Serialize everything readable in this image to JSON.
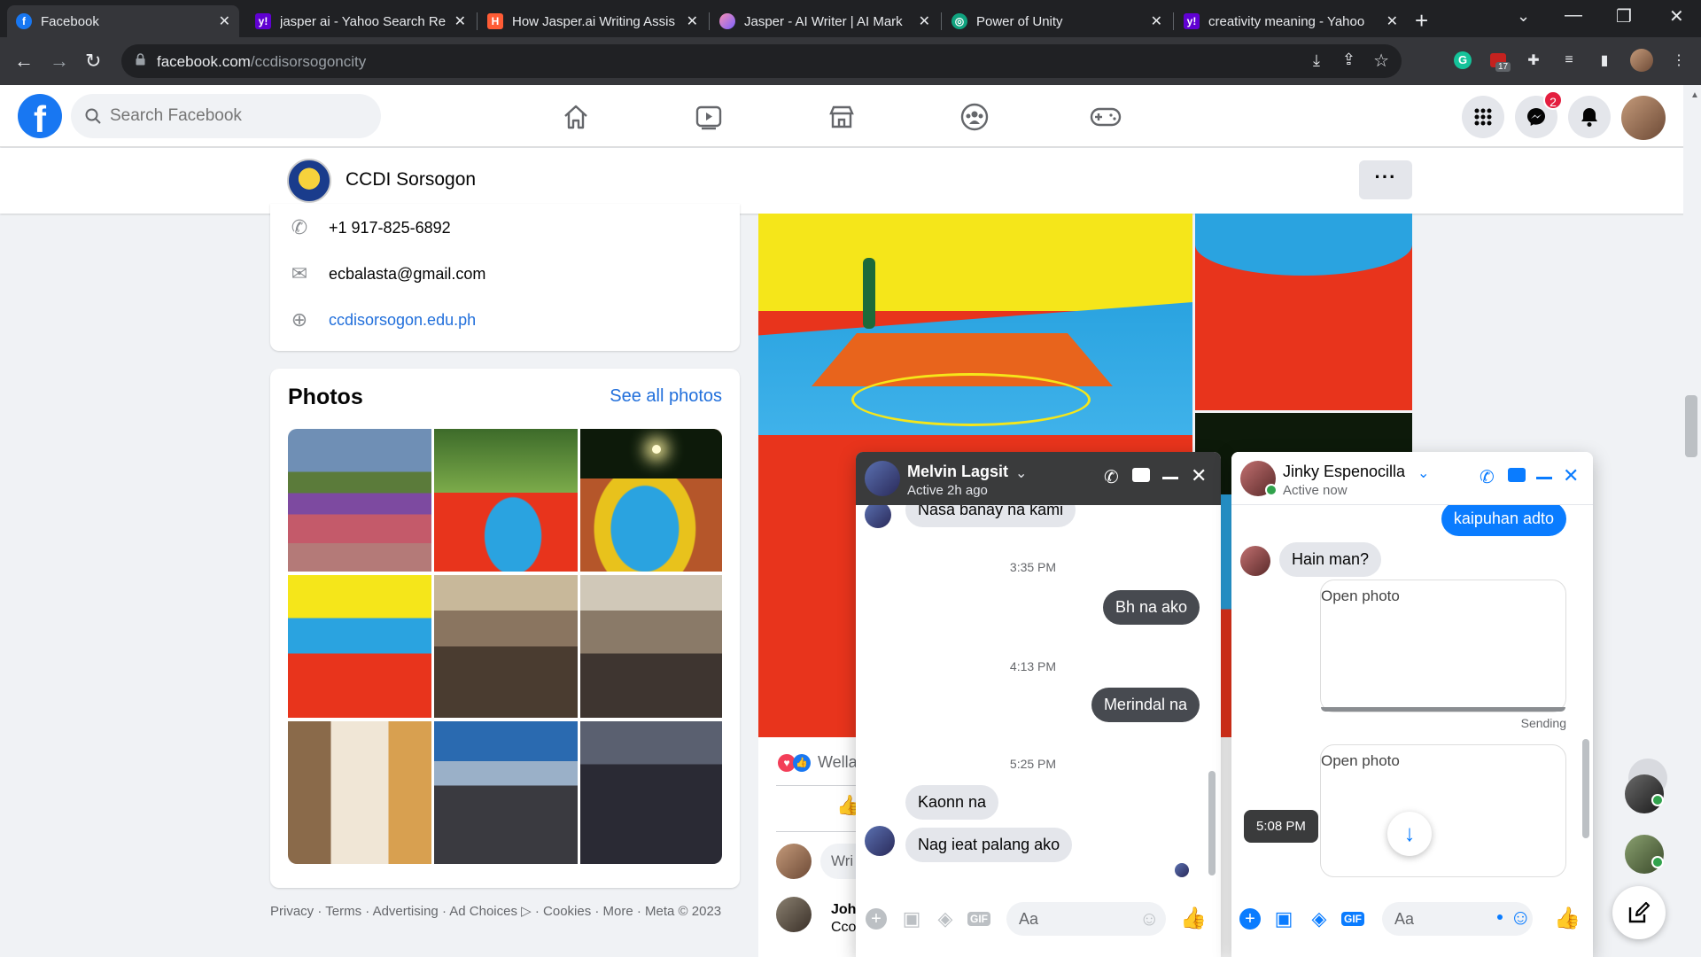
{
  "browser": {
    "tabs": [
      {
        "title": "Facebook",
        "favicon": "facebook-icon",
        "active": true
      },
      {
        "title": "jasper ai - Yahoo Search Re",
        "favicon": "yahoo-icon"
      },
      {
        "title": "How Jasper.ai Writing Assis",
        "favicon": "hubspot-icon"
      },
      {
        "title": "Jasper - AI Writer | AI Mark",
        "favicon": "jasper-icon"
      },
      {
        "title": "Power of Unity",
        "favicon": "openai-icon"
      },
      {
        "title": "creativity meaning - Yahoo",
        "favicon": "yahoo-icon"
      }
    ],
    "url_host": "facebook.com",
    "url_path": "/ccdisorsogoncity",
    "extension_badge": "17"
  },
  "fb": {
    "search_placeholder": "Search Facebook",
    "messenger_badge": "2"
  },
  "page": {
    "name": "CCDI Sorsogon",
    "more_label": "···"
  },
  "intro": {
    "phone": "+1 917-825-6892",
    "email": "ecbalasta@gmail.com",
    "website": "ccdisorsogon.edu.ph"
  },
  "photos": {
    "title": "Photos",
    "see_all": "See all photos"
  },
  "footer": "Privacy · Terms · Advertising · Ad Choices ▷ · Cookies · More · Meta © 2023",
  "post": {
    "reaction_text": "Wella",
    "comment_placeholder": "Wri",
    "commenter_name": "John",
    "commenter_text": "Cco"
  },
  "chat1": {
    "name": "Melvin Lagsit",
    "status": "Active 2h ago",
    "messages": [
      {
        "text": "Nasa banay na kami",
        "dir": "in"
      },
      {
        "time": "3:35 PM"
      },
      {
        "text": "Bh na ako",
        "dir": "out"
      },
      {
        "time": "4:13 PM"
      },
      {
        "text": "Merindal na",
        "dir": "out"
      },
      {
        "time": "5:25 PM"
      },
      {
        "text": "Kaonn na",
        "dir": "in"
      },
      {
        "text": "Nag ieat palang ako",
        "dir": "in"
      }
    ],
    "input_placeholder": "Aa"
  },
  "chat2": {
    "name": "Jinky Espenocilla",
    "status": "Active now",
    "messages": [
      {
        "text": "kaipuhan adto",
        "dir": "out"
      },
      {
        "text": "Hain man?",
        "dir": "in"
      },
      {
        "photo_alt": "Open photo",
        "status": "Sending"
      },
      {
        "photo_alt": "Open photo"
      }
    ],
    "tooltip_time": "5:08 PM",
    "input_placeholder": "Aa"
  },
  "colors": {
    "fb_blue": "#1877f2",
    "chrome_dark": "#202124",
    "chrome_tab": "#35363a",
    "court_red": "#e8341c",
    "court_blue": "#2aa3e0",
    "court_yellow": "#f5e61a"
  }
}
